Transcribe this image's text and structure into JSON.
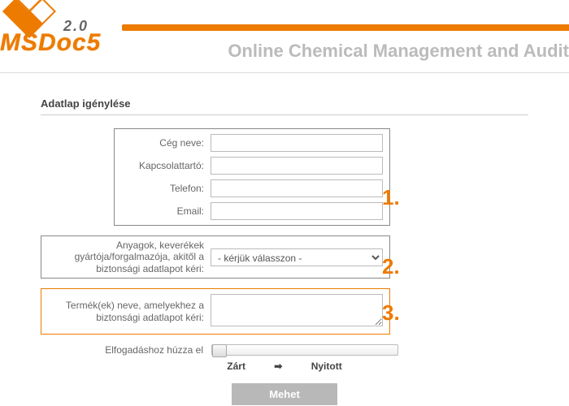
{
  "brand": {
    "version": "2.0",
    "name": "MSDoc5",
    "tagline": "Online Chemical Management and Audit"
  },
  "page": {
    "title": "Adatlap igénylése"
  },
  "section1": {
    "company_lbl": "Cég neve:",
    "contact_lbl": "Kapcsolattartó:",
    "phone_lbl": "Telefon:",
    "email_lbl": "Email:",
    "company": "",
    "contact": "",
    "phone": "",
    "email": ""
  },
  "section2": {
    "label": "Anyagok, keverékek gyártója/forgalmazója, akitől a biztonsági adatlapot kéri:",
    "placeholder": "- kérjük válasszon -"
  },
  "section3": {
    "label": "Termék(ek) neve, amelyekhez a biztonsági adatlapot kéri:",
    "value": ""
  },
  "steps": {
    "s1": "1.",
    "s2": "2.",
    "s3": "3."
  },
  "slider": {
    "label": "Elfogadáshoz húzza el",
    "closed": "Zárt",
    "open": "Nyitott"
  },
  "submit": {
    "label": "Mehet"
  }
}
